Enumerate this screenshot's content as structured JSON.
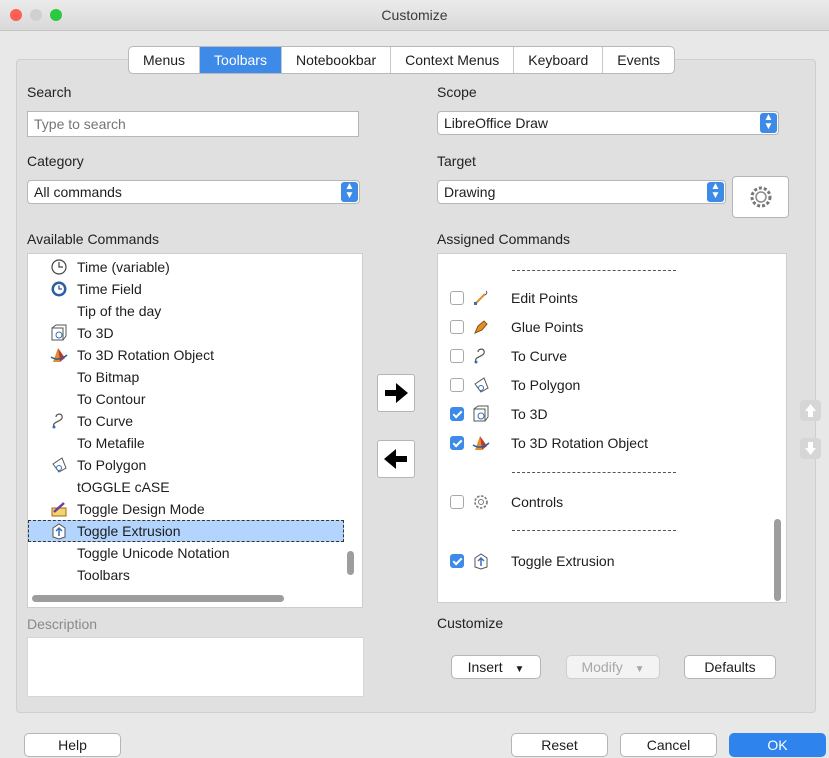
{
  "window": {
    "title": "Customize"
  },
  "tabs": [
    "Menus",
    "Toolbars",
    "Notebookbar",
    "Context Menus",
    "Keyboard",
    "Events"
  ],
  "active_tab": "Toolbars",
  "left": {
    "search_label": "Search",
    "search_placeholder": "Type to search",
    "category_label": "Category",
    "category_value": "All commands",
    "available_label": "Available Commands",
    "description_label": "Description",
    "commands": [
      {
        "label": "Time (variable)",
        "icon": "clock-outline-icon"
      },
      {
        "label": "Time Field",
        "icon": "clock-icon"
      },
      {
        "label": "Tip of the day",
        "icon": ""
      },
      {
        "label": "To 3D",
        "icon": "to-3d-icon"
      },
      {
        "label": "To 3D Rotation Object",
        "icon": "rotation-object-icon"
      },
      {
        "label": "To Bitmap",
        "icon": ""
      },
      {
        "label": "To Contour",
        "icon": ""
      },
      {
        "label": "To Curve",
        "icon": "curve-icon"
      },
      {
        "label": "To Metafile",
        "icon": ""
      },
      {
        "label": "To Polygon",
        "icon": "polygon-icon"
      },
      {
        "label": "tOGGLE cASE",
        "icon": ""
      },
      {
        "label": "Toggle Design Mode",
        "icon": "design-mode-icon"
      },
      {
        "label": "Toggle Extrusion",
        "icon": "extrusion-icon"
      },
      {
        "label": "Toggle Unicode Notation",
        "icon": ""
      },
      {
        "label": "Toolbars",
        "icon": ""
      }
    ],
    "selected_command": "Toggle Extrusion"
  },
  "right": {
    "scope_label": "Scope",
    "scope_value": "LibreOffice Draw",
    "target_label": "Target",
    "target_value": "Drawing",
    "assigned_label": "Assigned Commands",
    "customize_label": "Customize",
    "assigned": [
      {
        "type": "separator"
      },
      {
        "type": "item",
        "label": "Edit Points",
        "checked": false,
        "icon": "edit-points-icon"
      },
      {
        "type": "item",
        "label": "Glue Points",
        "checked": false,
        "icon": "glue-points-icon"
      },
      {
        "type": "item",
        "label": "To Curve",
        "checked": false,
        "icon": "curve-icon"
      },
      {
        "type": "item",
        "label": "To Polygon",
        "checked": false,
        "icon": "polygon-icon"
      },
      {
        "type": "item",
        "label": "To 3D",
        "checked": true,
        "icon": "to-3d-icon"
      },
      {
        "type": "item",
        "label": "To 3D Rotation Object",
        "checked": true,
        "icon": "rotation-object-icon"
      },
      {
        "type": "separator"
      },
      {
        "type": "item",
        "label": "Controls",
        "checked": false,
        "icon": "controls-icon"
      },
      {
        "type": "separator"
      },
      {
        "type": "item",
        "label": "Toggle Extrusion",
        "checked": true,
        "icon": "extrusion-icon"
      }
    ],
    "insert_label": "Insert",
    "modify_label": "Modify",
    "defaults_label": "Defaults"
  },
  "footer": {
    "help": "Help",
    "reset": "Reset",
    "cancel": "Cancel",
    "ok": "OK"
  },
  "colors": {
    "accent": "#3d8ae8",
    "selection": "#b3d4fc"
  }
}
